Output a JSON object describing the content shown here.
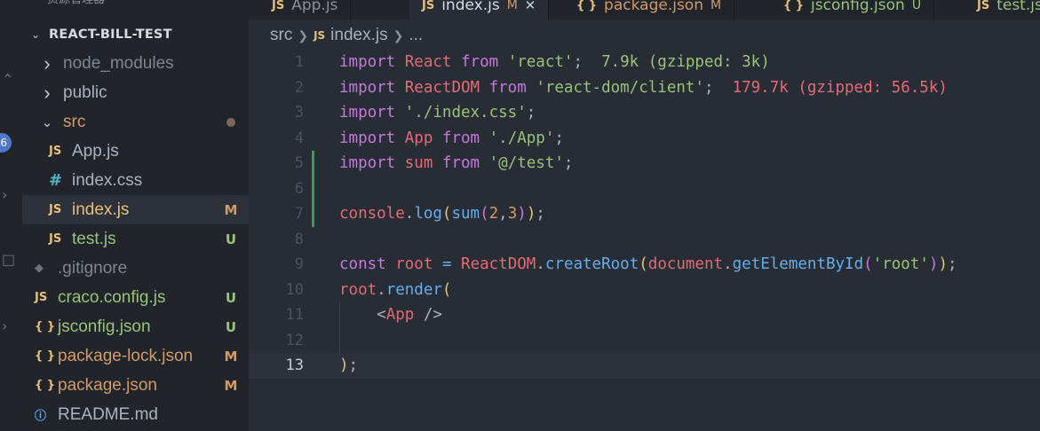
{
  "sidebar": {
    "top_title": "资源管理器",
    "project_name": "REACT-BILL-TEST",
    "badge_count": "6",
    "tree": [
      {
        "label": "node_modules",
        "kind": "folder",
        "open": false,
        "status": ""
      },
      {
        "label": "public",
        "kind": "folder",
        "open": false,
        "status": ""
      },
      {
        "label": "src",
        "kind": "folder",
        "open": true,
        "status": "dot"
      },
      {
        "label": "App.js",
        "kind": "js",
        "status": ""
      },
      {
        "label": "index.css",
        "kind": "css",
        "status": ""
      },
      {
        "label": "index.js",
        "kind": "js",
        "status": "M"
      },
      {
        "label": "test.js",
        "kind": "js",
        "status": "U"
      },
      {
        "label": ".gitignore",
        "kind": "git",
        "status": ""
      },
      {
        "label": "craco.config.js",
        "kind": "js",
        "status": "U"
      },
      {
        "label": "jsconfig.json",
        "kind": "json",
        "status": "U"
      },
      {
        "label": "package-lock.json",
        "kind": "json",
        "status": "M"
      },
      {
        "label": "package.json",
        "kind": "json",
        "status": "M"
      },
      {
        "label": "README.md",
        "kind": "info",
        "status": ""
      }
    ],
    "icons": {
      "js": "JS",
      "json": "{ }",
      "css": "#",
      "git": "◆",
      "info": "ⓘ"
    }
  },
  "tabs": [
    {
      "label": "App.js",
      "icon": "JS",
      "mark": ""
    },
    {
      "label": "index.js",
      "icon": "JS",
      "mark": "M",
      "close": "✕"
    },
    {
      "label": "package.json",
      "icon": "{ }",
      "mark": "M"
    },
    {
      "label": "jsconfig.json",
      "icon": "{ }",
      "mark": "U"
    },
    {
      "label": "test.js",
      "icon": "JS",
      "mark": ""
    }
  ],
  "breadcrumb": {
    "folder": "src",
    "icon": "JS",
    "file": "index.js",
    "more": "..."
  },
  "editor": {
    "current_line": 13,
    "lines": [
      {
        "n": "1",
        "tokens": [
          [
            "kw",
            "import"
          ],
          [
            "pl",
            " "
          ],
          [
            "var",
            "React"
          ],
          [
            "pl",
            " "
          ],
          [
            "kw",
            "from"
          ],
          [
            "pl",
            " "
          ],
          [
            "str",
            "'react'"
          ],
          [
            "pl",
            ";  "
          ],
          [
            "imp-ok",
            "7.9k (gzipped: 3k)"
          ]
        ]
      },
      {
        "n": "2",
        "tokens": [
          [
            "kw",
            "import"
          ],
          [
            "pl",
            " "
          ],
          [
            "var",
            "ReactDOM"
          ],
          [
            "pl",
            " "
          ],
          [
            "kw",
            "from"
          ],
          [
            "pl",
            " "
          ],
          [
            "str",
            "'react-dom/client'"
          ],
          [
            "pl",
            ";  "
          ],
          [
            "imp-big",
            "179.7k (gzipped: 56.5k)"
          ]
        ]
      },
      {
        "n": "3",
        "tokens": [
          [
            "kw",
            "import"
          ],
          [
            "pl",
            " "
          ],
          [
            "str",
            "'./index.css'"
          ],
          [
            "pl",
            ";"
          ]
        ]
      },
      {
        "n": "4",
        "tokens": [
          [
            "kw",
            "import"
          ],
          [
            "pl",
            " "
          ],
          [
            "var",
            "App"
          ],
          [
            "pl",
            " "
          ],
          [
            "kw",
            "from"
          ],
          [
            "pl",
            " "
          ],
          [
            "str",
            "'./App'"
          ],
          [
            "pl",
            ";"
          ]
        ]
      },
      {
        "n": "5",
        "git": true,
        "tokens": [
          [
            "kw",
            "import"
          ],
          [
            "pl",
            " "
          ],
          [
            "var",
            "sum"
          ],
          [
            "pl",
            " "
          ],
          [
            "kw",
            "from"
          ],
          [
            "pl",
            " "
          ],
          [
            "str",
            "'@/test'"
          ],
          [
            "pl",
            ";"
          ]
        ]
      },
      {
        "n": "6",
        "git": true,
        "tokens": []
      },
      {
        "n": "7",
        "git": true,
        "tokens": [
          [
            "var",
            "console"
          ],
          [
            "pl",
            "."
          ],
          [
            "fn",
            "log"
          ],
          [
            "paren2",
            "("
          ],
          [
            "fn",
            "sum"
          ],
          [
            "paren1",
            "("
          ],
          [
            "num",
            "2"
          ],
          [
            "pl",
            ","
          ],
          [
            "num",
            "3"
          ],
          [
            "paren1",
            ")"
          ],
          [
            "paren2",
            ")"
          ],
          [
            "pl",
            ";"
          ]
        ]
      },
      {
        "n": "8",
        "tokens": []
      },
      {
        "n": "9",
        "tokens": [
          [
            "kw",
            "const"
          ],
          [
            "pl",
            " "
          ],
          [
            "var",
            "root"
          ],
          [
            "pl",
            " "
          ],
          [
            "fn",
            "="
          ],
          [
            "pl",
            " "
          ],
          [
            "var",
            "ReactDOM"
          ],
          [
            "pl",
            "."
          ],
          [
            "fn",
            "createRoot"
          ],
          [
            "paren2",
            "("
          ],
          [
            "var",
            "document"
          ],
          [
            "pl",
            "."
          ],
          [
            "fn",
            "getElementById"
          ],
          [
            "paren1",
            "("
          ],
          [
            "str",
            "'root'"
          ],
          [
            "paren1",
            ")"
          ],
          [
            "paren2",
            ")"
          ],
          [
            "pl",
            ";"
          ]
        ]
      },
      {
        "n": "10",
        "tokens": [
          [
            "var",
            "root"
          ],
          [
            "pl",
            "."
          ],
          [
            "fn",
            "render"
          ],
          [
            "paren2",
            "("
          ]
        ]
      },
      {
        "n": "11",
        "guide": true,
        "tokens": [
          [
            "pl",
            "    <"
          ],
          [
            "var",
            "App"
          ],
          [
            "pl",
            " />"
          ]
        ]
      },
      {
        "n": "12",
        "guide": true,
        "tokens": []
      },
      {
        "n": "13",
        "tokens": [
          [
            "paren2",
            ")"
          ],
          [
            "pl",
            ";"
          ]
        ]
      }
    ]
  }
}
